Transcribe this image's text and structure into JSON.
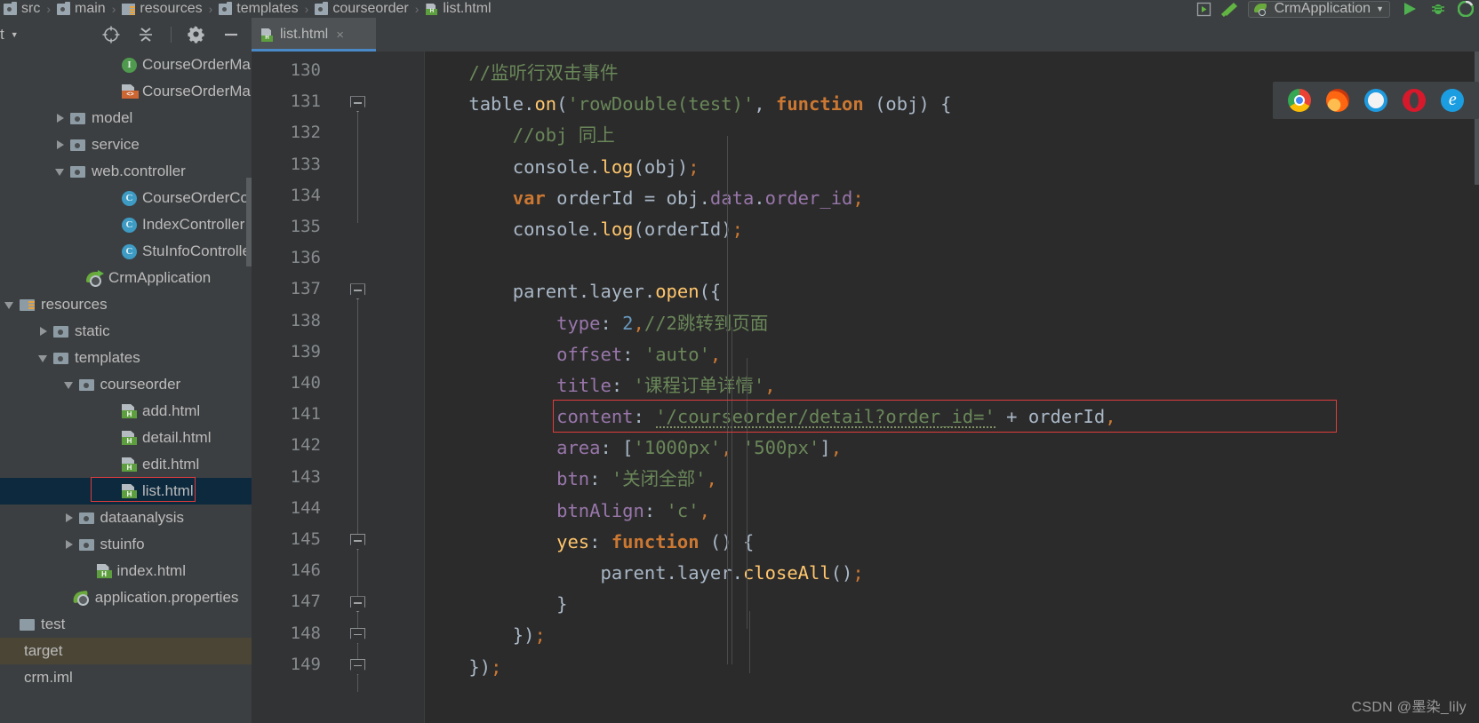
{
  "breadcrumb": [
    {
      "label": "src",
      "icon": "folder-icon"
    },
    {
      "label": "main",
      "icon": "folder-icon"
    },
    {
      "label": "resources",
      "icon": "resources-folder-icon"
    },
    {
      "label": "templates",
      "icon": "folder-icon"
    },
    {
      "label": "courseorder",
      "icon": "folder-icon"
    },
    {
      "label": "list.html",
      "icon": "html-file-icon"
    }
  ],
  "tool_window": {
    "title": "ect",
    "actions": [
      "locate-icon",
      "collapse-all-icon",
      "settings-icon",
      "hide-icon"
    ]
  },
  "tabs": [
    {
      "label": "list.html",
      "icon": "html-file-icon",
      "close": "×",
      "active": true
    }
  ],
  "toolbar": {
    "run_config": "CrmApplication",
    "items": [
      "build-icon",
      "hammer-icon",
      "run-icon",
      "debug-icon",
      "coverage-icon"
    ]
  },
  "tree": [
    {
      "label": "CourseOrderMapp",
      "icon": "interface-icon",
      "indent": 6,
      "arrow": "none",
      "state": "normal"
    },
    {
      "label": "CourseOrderMapp",
      "icon": "xml-file-icon",
      "indent": 6,
      "arrow": "none",
      "state": "normal"
    },
    {
      "label": "model",
      "icon": "folder-icon",
      "indent": 3,
      "arrow": "right",
      "state": "normal"
    },
    {
      "label": "service",
      "icon": "folder-icon",
      "indent": 3,
      "arrow": "right",
      "state": "normal"
    },
    {
      "label": "web.controller",
      "icon": "folder-icon",
      "indent": 3,
      "arrow": "down",
      "state": "normal"
    },
    {
      "label": "CourseOrderContr",
      "icon": "class-icon",
      "indent": 6,
      "arrow": "none",
      "state": "normal"
    },
    {
      "label": "IndexController",
      "icon": "class-icon",
      "indent": 6,
      "arrow": "none",
      "state": "normal"
    },
    {
      "label": "StuInfoController",
      "icon": "class-icon",
      "indent": 6,
      "arrow": "none",
      "state": "normal"
    },
    {
      "label": "CrmApplication",
      "icon": "spring-run-icon",
      "indent": 4,
      "arrow": "none",
      "state": "normal"
    },
    {
      "label": "resources",
      "icon": "resources-folder-icon",
      "indent": 0,
      "arrow": "down",
      "state": "normal"
    },
    {
      "label": "static",
      "icon": "folder-icon",
      "indent": 2,
      "arrow": "right",
      "state": "normal"
    },
    {
      "label": "templates",
      "icon": "folder-icon",
      "indent": 2,
      "arrow": "down",
      "state": "normal"
    },
    {
      "label": "courseorder",
      "icon": "folder-icon",
      "indent": 3.5,
      "arrow": "down",
      "state": "normal"
    },
    {
      "label": "add.html",
      "icon": "html-file-icon",
      "indent": 6,
      "arrow": "none",
      "state": "normal"
    },
    {
      "label": "detail.html",
      "icon": "html-file-icon",
      "indent": 6,
      "arrow": "none",
      "state": "normal"
    },
    {
      "label": "edit.html",
      "icon": "html-file-icon",
      "indent": 6,
      "arrow": "none",
      "state": "normal"
    },
    {
      "label": "list.html",
      "icon": "html-file-icon",
      "indent": 6,
      "arrow": "none",
      "state": "selected"
    },
    {
      "label": "dataanalysis",
      "icon": "folder-icon",
      "indent": 3.5,
      "arrow": "right",
      "state": "normal"
    },
    {
      "label": "stuinfo",
      "icon": "folder-icon",
      "indent": 3.5,
      "arrow": "right",
      "state": "normal"
    },
    {
      "label": "index.html",
      "icon": "html-file-icon",
      "indent": 4.5,
      "arrow": "none",
      "state": "normal"
    },
    {
      "label": "application.properties",
      "icon": "spring-leaf-icon",
      "indent": 3.2,
      "arrow": "none",
      "state": "normal"
    },
    {
      "label": "test",
      "icon": "plain-folder-icon",
      "indent": 0,
      "arrow": "none",
      "state": "normal"
    },
    {
      "label": "target",
      "icon": "none",
      "indent": 0,
      "arrow": "none",
      "state": "target"
    },
    {
      "label": "crm.iml",
      "icon": "none",
      "indent": 0,
      "arrow": "none",
      "state": "normal"
    }
  ],
  "editor": {
    "first_line": 130,
    "line_numbers": [
      130,
      131,
      132,
      133,
      134,
      135,
      136,
      137,
      138,
      139,
      140,
      141,
      142,
      143,
      144,
      145,
      146,
      147,
      148,
      149
    ],
    "fold_lines": [
      131,
      137,
      145,
      147,
      148,
      149
    ],
    "code_lines": [
      {
        "n": 130,
        "tokens": [
          {
            "t": "    ",
            "c": "ind"
          },
          {
            "t": "//监听行双击事件",
            "c": "c-comment"
          }
        ]
      },
      {
        "n": 131,
        "tokens": [
          {
            "t": "    ",
            "c": "ind"
          },
          {
            "t": "table",
            "c": "c-default"
          },
          {
            "t": ".",
            "c": "c-punc"
          },
          {
            "t": "on",
            "c": "c-fn"
          },
          {
            "t": "(",
            "c": "c-punc"
          },
          {
            "t": "'rowDouble(test)'",
            "c": "c-str"
          },
          {
            "t": ", ",
            "c": "c-punc"
          },
          {
            "t": "function",
            "c": "c-kw"
          },
          {
            "t": " (obj) {",
            "c": "c-default"
          }
        ]
      },
      {
        "n": 132,
        "tokens": [
          {
            "t": "        ",
            "c": "ind"
          },
          {
            "t": "//obj 同上",
            "c": "c-comment"
          }
        ]
      },
      {
        "n": 133,
        "tokens": [
          {
            "t": "        ",
            "c": "ind"
          },
          {
            "t": "console",
            "c": "c-default"
          },
          {
            "t": ".",
            "c": "c-punc"
          },
          {
            "t": "log",
            "c": "c-fn"
          },
          {
            "t": "(obj)",
            "c": "c-default"
          },
          {
            "t": ";",
            "c": "c-semi"
          }
        ]
      },
      {
        "n": 134,
        "tokens": [
          {
            "t": "        ",
            "c": "ind"
          },
          {
            "t": "var",
            "c": "c-kw"
          },
          {
            "t": " orderId = obj",
            "c": "c-default"
          },
          {
            "t": ".",
            "c": "c-punc"
          },
          {
            "t": "data",
            "c": "c-field"
          },
          {
            "t": ".",
            "c": "c-punc"
          },
          {
            "t": "order_id",
            "c": "c-field"
          },
          {
            "t": ";",
            "c": "c-semi"
          }
        ]
      },
      {
        "n": 135,
        "tokens": [
          {
            "t": "        ",
            "c": "ind"
          },
          {
            "t": "console",
            "c": "c-default"
          },
          {
            "t": ".",
            "c": "c-punc"
          },
          {
            "t": "log",
            "c": "c-fn"
          },
          {
            "t": "(orderId)",
            "c": "c-default"
          },
          {
            "t": ";",
            "c": "c-semi"
          }
        ]
      },
      {
        "n": 136,
        "tokens": []
      },
      {
        "n": 137,
        "tokens": [
          {
            "t": "        ",
            "c": "ind"
          },
          {
            "t": "parent",
            "c": "c-default"
          },
          {
            "t": ".",
            "c": "c-punc"
          },
          {
            "t": "layer",
            "c": "c-default"
          },
          {
            "t": ".",
            "c": "c-punc"
          },
          {
            "t": "open",
            "c": "c-fn"
          },
          {
            "t": "({",
            "c": "c-default"
          }
        ]
      },
      {
        "n": 138,
        "tokens": [
          {
            "t": "            ",
            "c": "ind"
          },
          {
            "t": "type",
            "c": "c-prop"
          },
          {
            "t": ": ",
            "c": "c-punc"
          },
          {
            "t": "2",
            "c": "c-num"
          },
          {
            "t": ",",
            "c": "c-semi"
          },
          {
            "t": "//2跳转到页面",
            "c": "c-comment"
          }
        ]
      },
      {
        "n": 139,
        "tokens": [
          {
            "t": "            ",
            "c": "ind"
          },
          {
            "t": "offset",
            "c": "c-prop"
          },
          {
            "t": ": ",
            "c": "c-punc"
          },
          {
            "t": "'auto'",
            "c": "c-str"
          },
          {
            "t": ",",
            "c": "c-semi"
          }
        ]
      },
      {
        "n": 140,
        "tokens": [
          {
            "t": "            ",
            "c": "ind"
          },
          {
            "t": "title",
            "c": "c-prop"
          },
          {
            "t": ": ",
            "c": "c-punc"
          },
          {
            "t": "'课程订单详情'",
            "c": "c-str"
          },
          {
            "t": ",",
            "c": "c-semi"
          }
        ]
      },
      {
        "n": 141,
        "tokens": [
          {
            "t": "            ",
            "c": "ind"
          },
          {
            "t": "content",
            "c": "c-prop"
          },
          {
            "t": ": ",
            "c": "c-punc"
          },
          {
            "t": "'/courseorder/detail?order_id='",
            "c": "c-str squig"
          },
          {
            "t": " + orderId",
            "c": "c-default"
          },
          {
            "t": ",",
            "c": "c-semi"
          }
        ]
      },
      {
        "n": 142,
        "tokens": [
          {
            "t": "            ",
            "c": "ind"
          },
          {
            "t": "area",
            "c": "c-prop"
          },
          {
            "t": ": [",
            "c": "c-punc"
          },
          {
            "t": "'1000px'",
            "c": "c-str"
          },
          {
            "t": ",",
            "c": "c-semi"
          },
          {
            "t": " ",
            "c": "c-punc"
          },
          {
            "t": "'500px'",
            "c": "c-str"
          },
          {
            "t": "]",
            "c": "c-punc"
          },
          {
            "t": ",",
            "c": "c-semi"
          }
        ]
      },
      {
        "n": 143,
        "tokens": [
          {
            "t": "            ",
            "c": "ind"
          },
          {
            "t": "btn",
            "c": "c-prop"
          },
          {
            "t": ": ",
            "c": "c-punc"
          },
          {
            "t": "'关闭全部'",
            "c": "c-str"
          },
          {
            "t": ",",
            "c": "c-semi"
          }
        ]
      },
      {
        "n": 144,
        "tokens": [
          {
            "t": "            ",
            "c": "ind"
          },
          {
            "t": "btnAlign",
            "c": "c-prop"
          },
          {
            "t": ": ",
            "c": "c-punc"
          },
          {
            "t": "'c'",
            "c": "c-str"
          },
          {
            "t": ",",
            "c": "c-semi"
          }
        ]
      },
      {
        "n": 145,
        "tokens": [
          {
            "t": "            ",
            "c": "ind"
          },
          {
            "t": "yes",
            "c": "c-fn"
          },
          {
            "t": ": ",
            "c": "c-punc"
          },
          {
            "t": "function",
            "c": "c-kw"
          },
          {
            "t": " () {",
            "c": "c-default"
          }
        ]
      },
      {
        "n": 146,
        "tokens": [
          {
            "t": "                ",
            "c": "ind"
          },
          {
            "t": "parent",
            "c": "c-default"
          },
          {
            "t": ".",
            "c": "c-punc"
          },
          {
            "t": "layer",
            "c": "c-default"
          },
          {
            "t": ".",
            "c": "c-punc"
          },
          {
            "t": "closeAll",
            "c": "c-fn"
          },
          {
            "t": "()",
            "c": "c-default"
          },
          {
            "t": ";",
            "c": "c-semi"
          }
        ]
      },
      {
        "n": 147,
        "tokens": [
          {
            "t": "            ",
            "c": "ind"
          },
          {
            "t": "}",
            "c": "c-default"
          }
        ]
      },
      {
        "n": 148,
        "tokens": [
          {
            "t": "        ",
            "c": "ind"
          },
          {
            "t": "})",
            "c": "c-default"
          },
          {
            "t": ";",
            "c": "c-semi"
          }
        ]
      },
      {
        "n": 149,
        "tokens": [
          {
            "t": "    ",
            "c": "ind"
          },
          {
            "t": "})",
            "c": "c-default"
          },
          {
            "t": ";",
            "c": "c-semi"
          }
        ]
      }
    ]
  },
  "browsers": [
    {
      "name": "chrome-icon"
    },
    {
      "name": "firefox-icon"
    },
    {
      "name": "safari-icon"
    },
    {
      "name": "opera-icon"
    },
    {
      "name": "edge-icon"
    }
  ],
  "watermark": "CSDN @墨染_lily",
  "colors": {
    "editor_bg": "#2b2b2b",
    "gutter_bg": "#313335",
    "panel_bg": "#3c3f41",
    "selection": "#0d293e",
    "target_row": "#4b4535",
    "accent": "#4a88c7",
    "highlight_box": "#e03c3c",
    "string": "#6a8759",
    "keyword": "#cc7832",
    "property": "#9876aa",
    "function": "#ffc66d",
    "number": "#6897bb",
    "text": "#a9b7c6"
  }
}
